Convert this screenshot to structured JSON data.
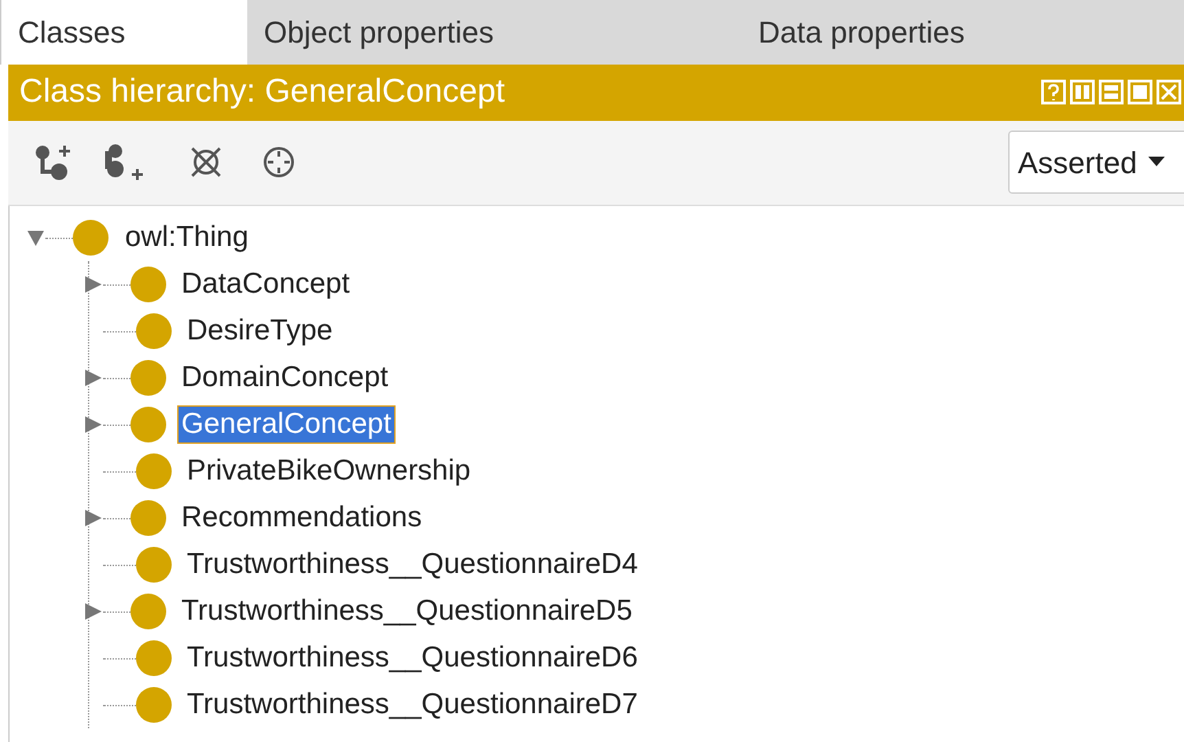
{
  "tabs": [
    {
      "label": "Classes",
      "selected": true
    },
    {
      "label": "Object properties",
      "selected": false
    },
    {
      "label": "Data properties",
      "selected": false
    }
  ],
  "view": {
    "title": "Class hierarchy: GeneralConcept"
  },
  "toolbar": {
    "mode_dropdown": "Asserted"
  },
  "tree": {
    "label": "owl:Thing",
    "expanded": true,
    "selected": false,
    "children": [
      {
        "label": "DataConcept",
        "expandable": true,
        "selected": false
      },
      {
        "label": "DesireType",
        "expandable": false,
        "selected": false
      },
      {
        "label": "DomainConcept",
        "expandable": true,
        "selected": false
      },
      {
        "label": "GeneralConcept",
        "expandable": true,
        "selected": true
      },
      {
        "label": "PrivateBikeOwnership",
        "expandable": false,
        "selected": false
      },
      {
        "label": "Recommendations",
        "expandable": true,
        "selected": false
      },
      {
        "label": "Trustworthiness__QuestionnaireD4",
        "expandable": false,
        "selected": false
      },
      {
        "label": "Trustworthiness__QuestionnaireD5",
        "expandable": true,
        "selected": false
      },
      {
        "label": "Trustworthiness__QuestionnaireD6",
        "expandable": false,
        "selected": false
      },
      {
        "label": "Trustworthiness__QuestionnaireD7",
        "expandable": false,
        "selected": false
      }
    ]
  }
}
